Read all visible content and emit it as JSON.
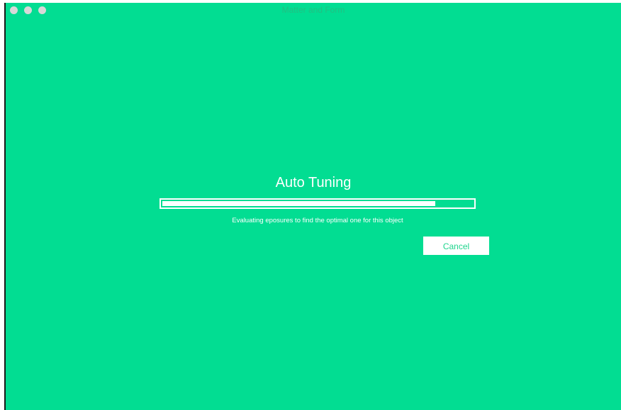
{
  "window": {
    "title": "Matter and Form",
    "background": "#02dd92"
  },
  "dialog": {
    "heading": "Auto Tuning",
    "progress_fraction": 0.88,
    "status_text": "Evaluating eposures to find the optimal one for this object",
    "cancel_label": "Cancel"
  }
}
